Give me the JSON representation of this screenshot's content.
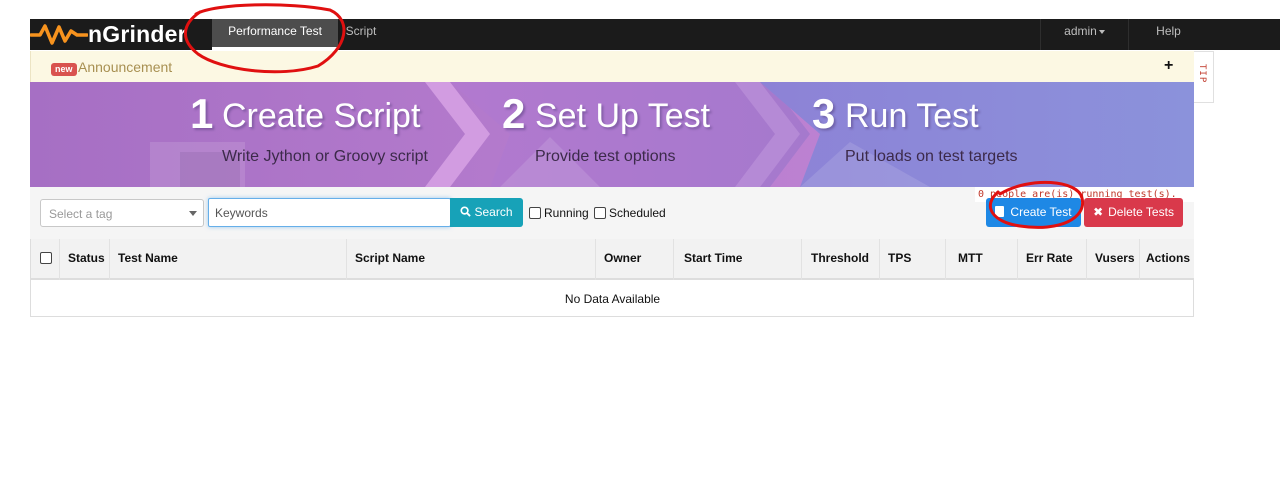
{
  "navbar": {
    "brand": "nGrinder",
    "tabs": [
      {
        "label": "Performance Test",
        "active": true
      },
      {
        "label": "Script",
        "active": false
      }
    ],
    "user_menu": "admin",
    "help": "Help"
  },
  "announcement": {
    "badge": "new",
    "label": "Announcement",
    "expand_symbol": "+"
  },
  "tip_tab": "TIP",
  "banner": {
    "steps": [
      {
        "number": "1",
        "title": "Create Script",
        "subtitle": "Write Jython or Groovy script"
      },
      {
        "number": "2",
        "title": "Set Up Test",
        "subtitle": "Provide test options"
      },
      {
        "number": "3",
        "title": "Run Test",
        "subtitle": "Put loads on test targets"
      }
    ]
  },
  "toolbar": {
    "running_status": "0 people are(is) running test(s).",
    "tag_placeholder": "Select a tag",
    "keyword_placeholder": "Keywords",
    "search_label": "Search",
    "running_label": "Running",
    "scheduled_label": "Scheduled",
    "create_label": "Create Test",
    "delete_label": "Delete Tests"
  },
  "table": {
    "columns": [
      "Status",
      "Test Name",
      "Script Name",
      "Owner",
      "Start Time",
      "Threshold",
      "TPS",
      "MTT",
      "Err Rate",
      "Vusers",
      "Actions"
    ],
    "empty_text": "No Data Available"
  },
  "colors": {
    "navbar_bg": "#1b1b1b",
    "accent_orange": "#f7931e",
    "announce_bg": "#fcf8e3",
    "search_btn": "#17a2b8",
    "create_btn": "#1e88e5",
    "delete_btn": "#d9394b",
    "annotation_red": "#e01010"
  }
}
